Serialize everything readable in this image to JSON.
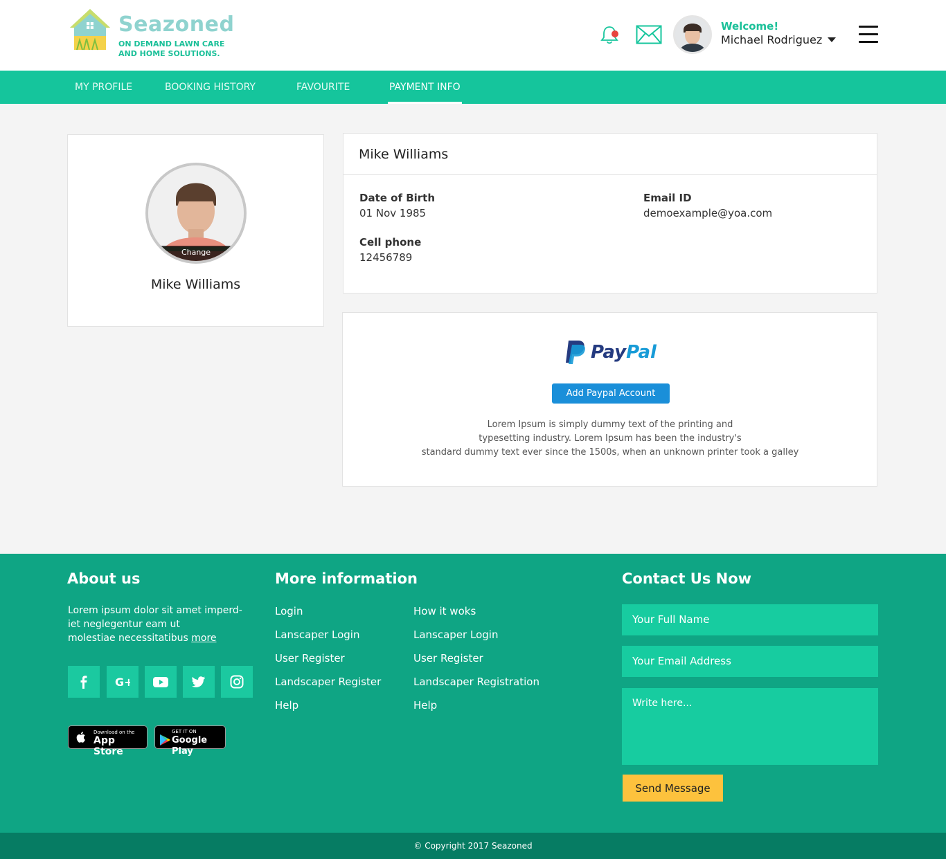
{
  "brand": {
    "name": "Seazoned",
    "tagline_line1": "ON DEMAND LAWN CARE",
    "tagline_line2": "AND HOME SOLUTIONS."
  },
  "header": {
    "welcome": "Welcome!",
    "user_name": "Michael Rodriguez",
    "icons": [
      "bell-icon",
      "mail-icon",
      "menu-icon",
      "chevron-down-icon"
    ]
  },
  "nav": {
    "tabs": [
      {
        "label": "MY PROFILE",
        "active": false
      },
      {
        "label": "BOOKING HISTORY",
        "active": false
      },
      {
        "label": "FAVOURITE",
        "active": false
      },
      {
        "label": "PAYMENT INFO",
        "active": true
      }
    ]
  },
  "profile": {
    "name": "Mike Williams",
    "change_label": "Change"
  },
  "details": {
    "title": "Mike Williams",
    "dob_label": "Date of Birth",
    "dob_value": "01 Nov 1985",
    "email_label": "Email ID",
    "email_value": "demoexample@yoa.com",
    "phone_label": "Cell phone",
    "phone_value": "12456789"
  },
  "payment": {
    "logo_pay": "Pay",
    "logo_pal": "Pal",
    "button_label": "Add Paypal Account",
    "desc_line1": "Lorem Ipsum is simply dummy text of the printing and",
    "desc_line2": "typesetting industry. Lorem Ipsum has been the industry's",
    "desc_line3": "standard dummy text ever since the 1500s, when an unknown printer took a galley"
  },
  "footer": {
    "about_heading": "About us",
    "about_text_line1": "Lorem ipsum dolor sit amet imperd-",
    "about_text_line2": "iet neglegentur eam ut",
    "about_text_line3": "molestiae necessitatibus ",
    "about_more": "more",
    "social_icons": [
      "facebook-icon",
      "google-plus-icon",
      "youtube-icon",
      "twitter-icon",
      "instagram-icon"
    ],
    "app_store_small": "Download on the",
    "app_store_big": "App Store",
    "google_play_small": "GET IT ON",
    "google_play_big": "Google Play",
    "more_heading": "More information",
    "links_col1": [
      "Login",
      "Lanscaper Login",
      "User Register",
      "Landscaper Register",
      "Help"
    ],
    "links_col2": [
      "How it woks",
      "Lanscaper Login",
      "User Register",
      "Landscaper Registration",
      "Help"
    ],
    "contact_heading": "Contact Us Now",
    "name_placeholder": "Your Full Name",
    "email_placeholder": "Your Email Address",
    "message_placeholder": "Write here...",
    "send_label": "Send Message",
    "copyright": "© Copyright 2017 Seazoned"
  },
  "colors": {
    "brand_green": "#15c59c",
    "footer_green": "#0fa584",
    "footer_dark": "#067c63",
    "paypal_button": "#1a8fd9",
    "send_button": "#fdc23d"
  }
}
